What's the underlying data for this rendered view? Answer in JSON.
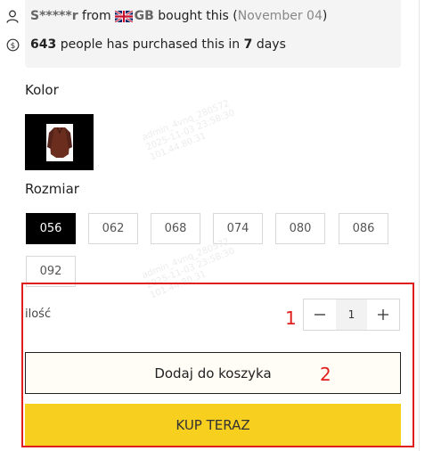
{
  "social_proof": {
    "buyer_masked": "S*****r",
    "from_text": "from",
    "country_code": "GB",
    "bought_text": "bought this (",
    "date": "November 04",
    "close_paren": ")",
    "purchase_count": "643",
    "purchase_text": "people has purchased this in",
    "days_count": "7",
    "days_text": "days"
  },
  "color_section": {
    "label": "Kolor"
  },
  "size_section": {
    "label": "Rozmiar",
    "sizes": [
      "056",
      "062",
      "068",
      "074",
      "080",
      "086",
      "092"
    ],
    "selected": "056"
  },
  "quantity": {
    "label": "ilość",
    "value": "1",
    "minus": "−",
    "plus": "+"
  },
  "buttons": {
    "add_to_cart": "Dodaj do koszyka",
    "buy_now": "KUP TERAZ"
  },
  "annotations": {
    "marker_1": "1",
    "marker_2": "2"
  },
  "watermark": {
    "text": "admin_4vnq_280572\n2025-11-03 23:58:30\n101.44.80.31"
  },
  "colors": {
    "accent_buy": "#f7cf1f",
    "selected_size": "#000000",
    "annotation_red": "#e01e1e"
  }
}
